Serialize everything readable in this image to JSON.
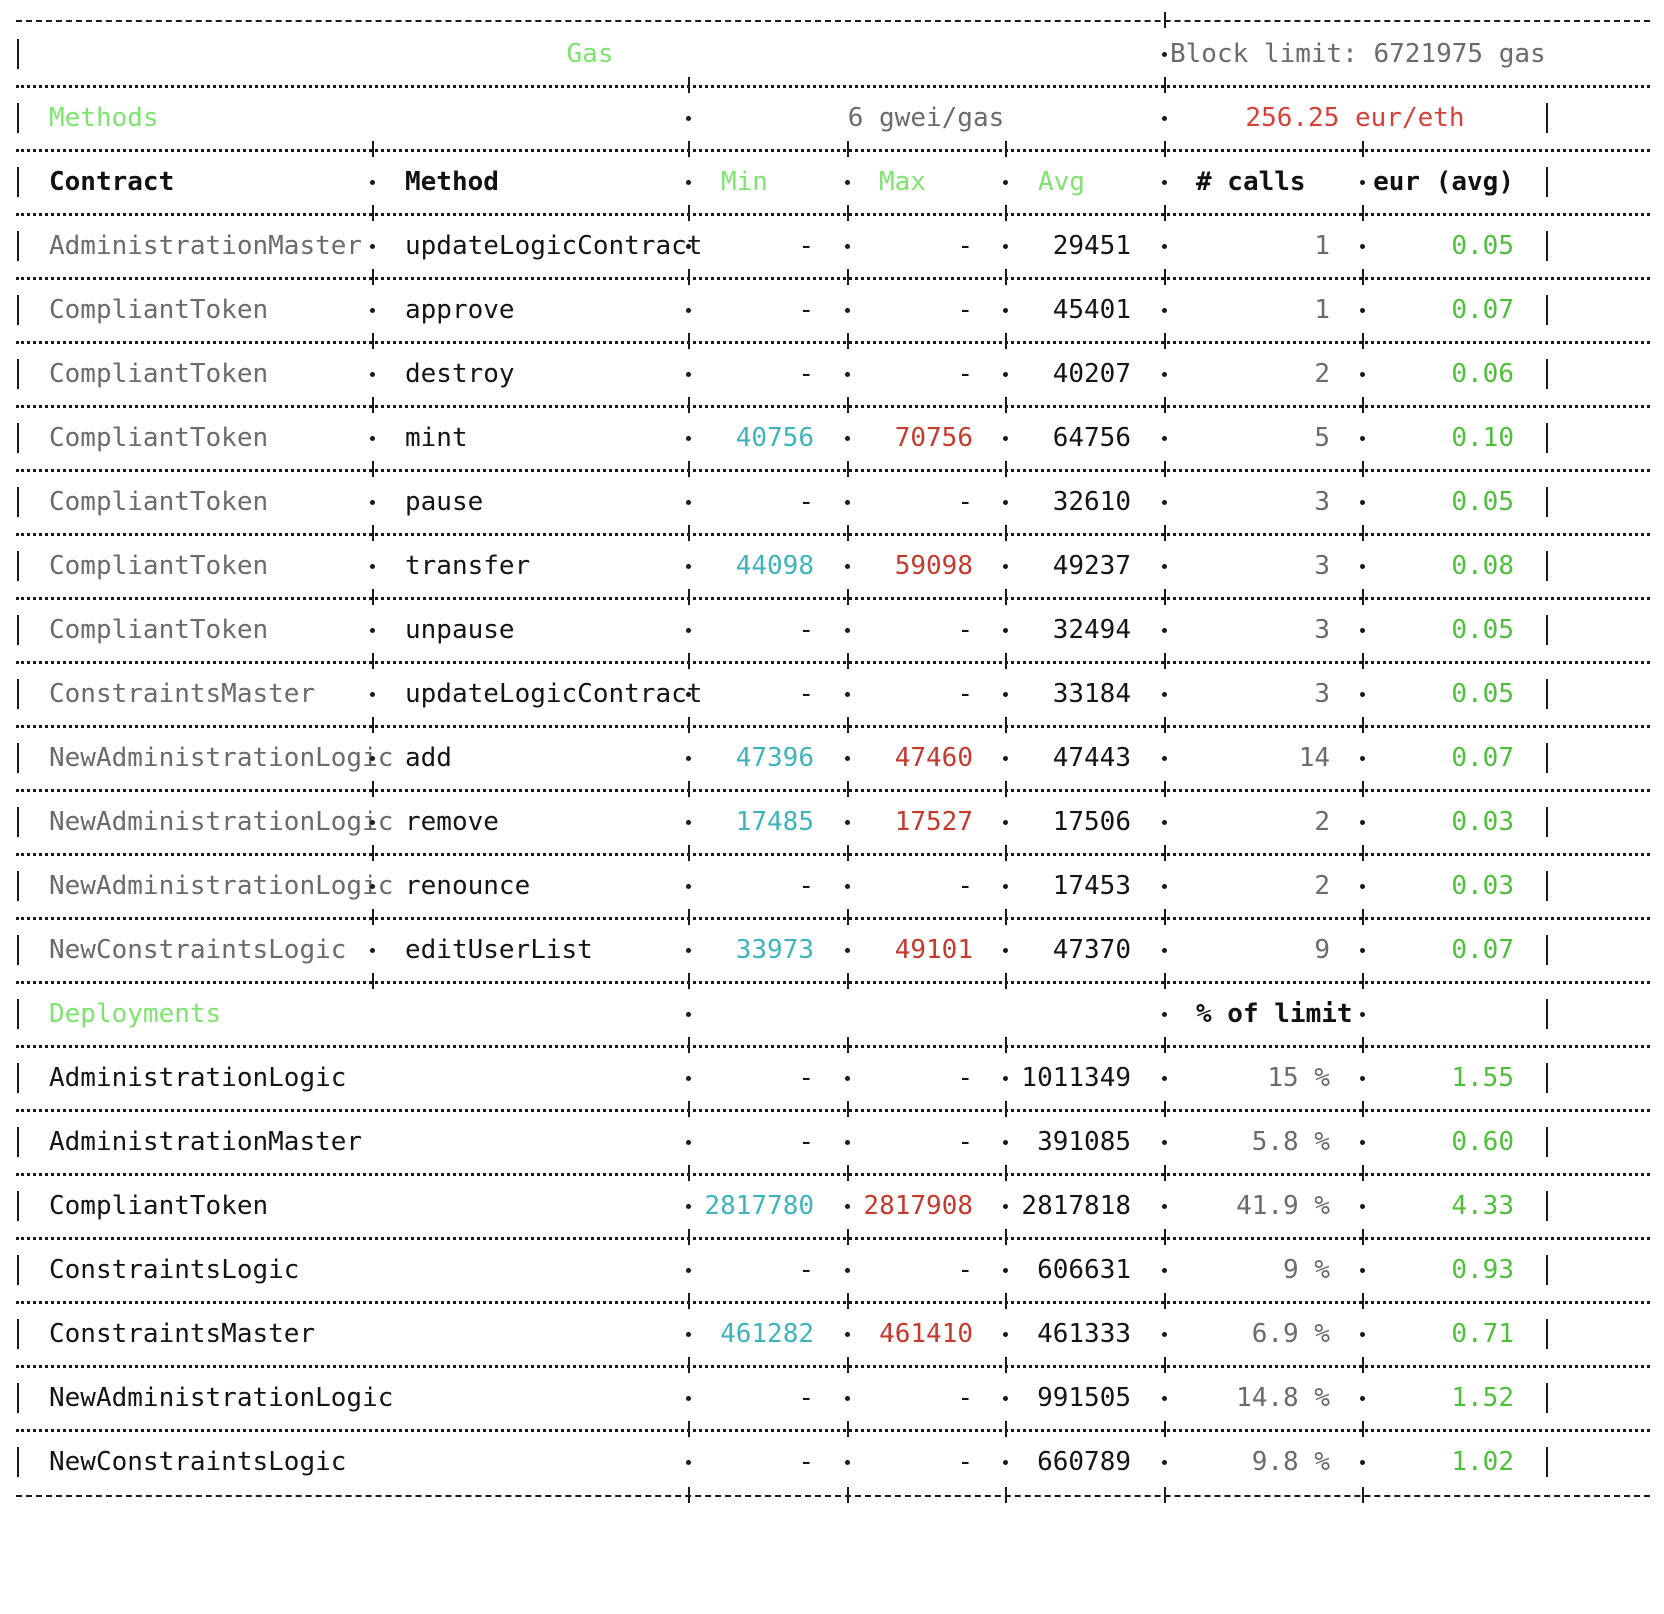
{
  "header": {
    "title": "Gas",
    "block_limit": "Block limit: 6721975 gas",
    "methods_label": "Methods",
    "gas_price": "6 gwei/gas",
    "eth_price": "256.25 eur/eth",
    "deployments_label": "Deployments",
    "pct_of_limit_label": "% of limit"
  },
  "columns": {
    "contract": "Contract",
    "method": "Method",
    "min": "Min",
    "max": "Max",
    "avg": "Avg",
    "calls": "# calls",
    "eur_avg": "eur (avg)"
  },
  "methods": [
    {
      "contract": "AdministrationMaster",
      "method": "updateLogicContract",
      "min": "-",
      "max": "-",
      "avg": "29451",
      "calls": "1",
      "eur": "0.05"
    },
    {
      "contract": "CompliantToken",
      "method": "approve",
      "min": "-",
      "max": "-",
      "avg": "45401",
      "calls": "1",
      "eur": "0.07"
    },
    {
      "contract": "CompliantToken",
      "method": "destroy",
      "min": "-",
      "max": "-",
      "avg": "40207",
      "calls": "2",
      "eur": "0.06"
    },
    {
      "contract": "CompliantToken",
      "method": "mint",
      "min": "40756",
      "max": "70756",
      "avg": "64756",
      "calls": "5",
      "eur": "0.10"
    },
    {
      "contract": "CompliantToken",
      "method": "pause",
      "min": "-",
      "max": "-",
      "avg": "32610",
      "calls": "3",
      "eur": "0.05"
    },
    {
      "contract": "CompliantToken",
      "method": "transfer",
      "min": "44098",
      "max": "59098",
      "avg": "49237",
      "calls": "3",
      "eur": "0.08"
    },
    {
      "contract": "CompliantToken",
      "method": "unpause",
      "min": "-",
      "max": "-",
      "avg": "32494",
      "calls": "3",
      "eur": "0.05"
    },
    {
      "contract": "ConstraintsMaster",
      "method": "updateLogicContract",
      "min": "-",
      "max": "-",
      "avg": "33184",
      "calls": "3",
      "eur": "0.05"
    },
    {
      "contract": "NewAdministrationLogic",
      "method": "add",
      "min": "47396",
      "max": "47460",
      "avg": "47443",
      "calls": "14",
      "eur": "0.07"
    },
    {
      "contract": "NewAdministrationLogic",
      "method": "remove",
      "min": "17485",
      "max": "17527",
      "avg": "17506",
      "calls": "2",
      "eur": "0.03"
    },
    {
      "contract": "NewAdministrationLogic",
      "method": "renounce",
      "min": "-",
      "max": "-",
      "avg": "17453",
      "calls": "2",
      "eur": "0.03"
    },
    {
      "contract": "NewConstraintsLogic",
      "method": "editUserList",
      "min": "33973",
      "max": "49101",
      "avg": "47370",
      "calls": "9",
      "eur": "0.07"
    }
  ],
  "deployments": [
    {
      "contract": "AdministrationLogic",
      "min": "-",
      "max": "-",
      "avg": "1011349",
      "pct": "15 %",
      "eur": "1.55"
    },
    {
      "contract": "AdministrationMaster",
      "min": "-",
      "max": "-",
      "avg": "391085",
      "pct": "5.8 %",
      "eur": "0.60"
    },
    {
      "contract": "CompliantToken",
      "min": "2817780",
      "max": "2817908",
      "avg": "2817818",
      "pct": "41.9 %",
      "eur": "4.33"
    },
    {
      "contract": "ConstraintsLogic",
      "min": "-",
      "max": "-",
      "avg": "606631",
      "pct": "9 %",
      "eur": "0.93"
    },
    {
      "contract": "ConstraintsMaster",
      "min": "461282",
      "max": "461410",
      "avg": "461333",
      "pct": "6.9 %",
      "eur": "0.71"
    },
    {
      "contract": "NewAdministrationLogic",
      "min": "-",
      "max": "-",
      "avg": "991505",
      "pct": "14.8 %",
      "eur": "1.52"
    },
    {
      "contract": "NewConstraintsLogic",
      "min": "-",
      "max": "-",
      "avg": "660789",
      "pct": "9.8 %",
      "eur": "1.02"
    }
  ],
  "colors": {
    "highlight_green": "#7ee36f",
    "min_cyan": "#40b3bb",
    "max_red": "#c43a2e",
    "eur_green": "#4fbf3a",
    "contract_grey": "#6b6b6b",
    "eth_price_red": "#d4423a"
  }
}
